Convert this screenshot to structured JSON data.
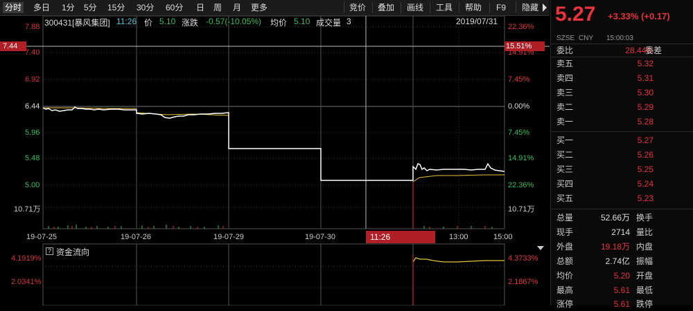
{
  "toolbar": {
    "periods": [
      "分时",
      "多日",
      "1分",
      "5分",
      "15分",
      "30分",
      "60分",
      "日",
      "周",
      "月",
      "更多"
    ],
    "tools": [
      "竞价",
      "叠加",
      "画线",
      "工具",
      "帮助",
      "F9",
      "隐藏"
    ]
  },
  "info": {
    "code_name": "300431[暴风集团]",
    "time": "11:26",
    "price_label": "价",
    "price": "5.10",
    "change_label": "涨跌",
    "change": "-0.57(-10.05%)",
    "avg_label": "均价",
    "avg": "5.10",
    "vol_label": "成交量",
    "vol": "3",
    "date": "2019/07/31"
  },
  "axis": {
    "left_prices": [
      "7.88",
      "7.40",
      "6.92",
      "6.44",
      "5.96",
      "5.48",
      "5.00"
    ],
    "left_vol": "10.71万",
    "right_pcts": [
      "22.36%",
      "14.91%",
      "7.45%",
      "0.00%",
      "7.45%",
      "14.91%",
      "22.36%"
    ],
    "right_vol": "10.71万",
    "cursor_price": "7.44",
    "cursor_pct": "15.51%",
    "x_dates": [
      "19-07-25",
      "19-07-26",
      "19-07-29",
      "19-07-30"
    ],
    "cursor_time": "11:26",
    "x_times": [
      "13:00",
      "15:00"
    ]
  },
  "flow": {
    "title": "资金流向",
    "left_vals": [
      "4.1919%",
      "2.0341%"
    ],
    "right_vals": [
      "4.3733%",
      "2.1867%"
    ]
  },
  "quote": {
    "price": "5.27",
    "change": "+3.33% (+0.17)",
    "exchange": "SZSE",
    "currency": "CNY",
    "time": "15:00:03",
    "wei_bi_label": "委比",
    "wei_bi": "28.44%",
    "wei_cha_label": "委差",
    "asks": [
      {
        "label": "卖五",
        "price": "5.32"
      },
      {
        "label": "卖四",
        "price": "5.31"
      },
      {
        "label": "卖三",
        "price": "5.30"
      },
      {
        "label": "卖二",
        "price": "5.29"
      },
      {
        "label": "卖一",
        "price": "5.28"
      }
    ],
    "bids": [
      {
        "label": "买一",
        "price": "5.27"
      },
      {
        "label": "买二",
        "price": "5.26"
      },
      {
        "label": "买三",
        "price": "5.25"
      },
      {
        "label": "买四",
        "price": "5.24"
      },
      {
        "label": "买五",
        "price": "5.23"
      }
    ],
    "stats": [
      {
        "l1": "总量",
        "v1": "52.66万",
        "l2": "换手"
      },
      {
        "l1": "现手",
        "v1": "2714",
        "l2": "量比"
      },
      {
        "l1": "外盘",
        "v1": "19.18万",
        "l2": "内盘"
      },
      {
        "l1": "总额",
        "v1": "2.74亿",
        "l2": "振幅"
      },
      {
        "l1": "均价",
        "v1": "5.20",
        "l2": "开盘"
      },
      {
        "l1": "最高",
        "v1": "5.61",
        "l2": "最低"
      },
      {
        "l1": "涨停",
        "v1": "5.61",
        "l2": "跌停"
      }
    ]
  },
  "colors": {
    "up": "#e8323c",
    "down": "#2fc05a",
    "line": "#ffffff",
    "avg": "#e8c23a"
  }
}
